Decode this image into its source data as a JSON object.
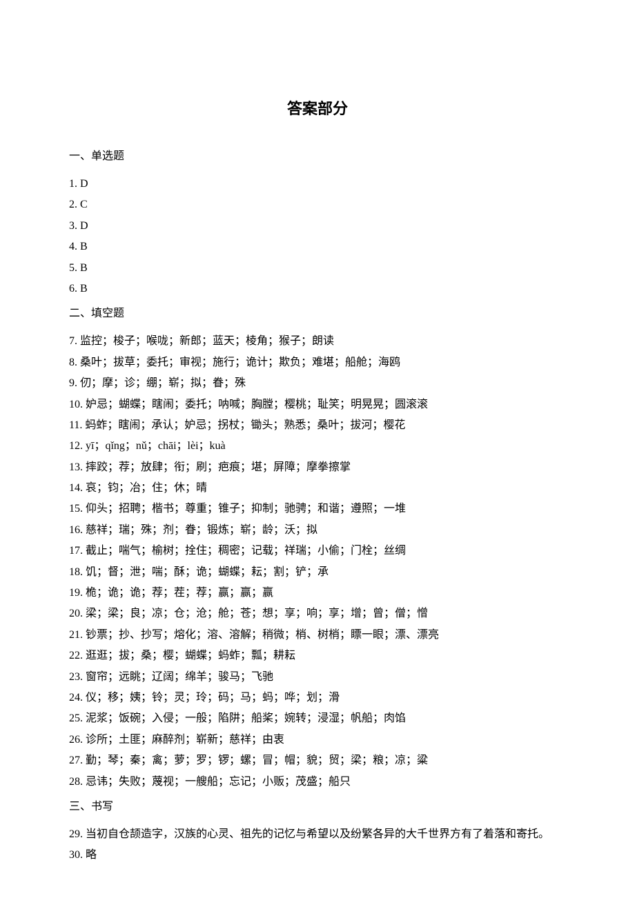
{
  "title": "答案部分",
  "sections": [
    {
      "heading": "一、单选题",
      "items": [
        {
          "num": "1.",
          "text": "D"
        },
        {
          "num": "2.",
          "text": "C"
        },
        {
          "num": "3.",
          "text": "D"
        },
        {
          "num": "4.",
          "text": "B"
        },
        {
          "num": "5.",
          "text": "B"
        },
        {
          "num": "6.",
          "text": "B"
        }
      ]
    },
    {
      "heading": "二、填空题",
      "items": [
        {
          "num": "7.",
          "text": "监控；梭子；喉咙；新郎；蓝天；棱角；猴子；朗读"
        },
        {
          "num": "8.",
          "text": "桑叶；拔草；委托；审视；施行；诡计；欺负；难堪；船舱；海鸥"
        },
        {
          "num": "9.",
          "text": "仞；摩；诊；绷；崭；拟；眷；殊"
        },
        {
          "num": "10.",
          "text": "妒忌；蝴蝶；瞎闹；委托；呐喊；胸膛；樱桃；耻笑；明晃晃；圆滚滚"
        },
        {
          "num": "11.",
          "text": "蚂蚱；瞎闹；承认；妒忌；拐杖；锄头；熟悉；桑叶；拔河；樱花"
        },
        {
          "num": "12.",
          "text": "yī；qǐng；nǔ；chāi；lèi；kuà"
        },
        {
          "num": "13.",
          "text": "摔跤；荐；放肆；衔；刷；疤痕；堪；屏障；摩拳擦掌"
        },
        {
          "num": "14.",
          "text": "哀；钧；冶；住；休；晴"
        },
        {
          "num": "15.",
          "text": "仰头；招聘；楷书；尊重；锥子；抑制；驰骋；和谐；遵照；一堆"
        },
        {
          "num": "16.",
          "text": "慈祥；瑞；殊；剂；眷；锻炼；崭；龄；沃；拟"
        },
        {
          "num": "17.",
          "text": "截止；喘气；榆树；拴住；稠密；记载；祥瑞；小偷；门栓；丝绸"
        },
        {
          "num": "18.",
          "text": "饥；督；泄；喘；酥；诡；蝴蝶；耘；割；铲；承"
        },
        {
          "num": "19.",
          "text": "桅；诡；诡；荐；茬；荐；赢；赢；赢"
        },
        {
          "num": "20.",
          "text": "梁；梁；良；凉；仓；沧；舱；苍；想；享；响；享；增；曾；僧；憎"
        },
        {
          "num": "21.",
          "text": "钞票；抄、抄写；熔化；溶、溶解；稍微；梢、树梢；瞟一眼；漂、漂亮"
        },
        {
          "num": "22.",
          "text": "逛逛；拔；桑；樱；蝴蝶；蚂蚱；瓢；耕耘"
        },
        {
          "num": "23.",
          "text": "窗帘；远眺；辽阔；绵羊；骏马；飞驰"
        },
        {
          "num": "24.",
          "text": "仪；移；姨；铃；灵；玲；码；马；蚂；哗；划；滑"
        },
        {
          "num": "25.",
          "text": "泥浆；饭碗；入侵；一般；陷阱；船桨；婉转；浸湿；帆船；肉馅"
        },
        {
          "num": "26.",
          "text": "诊所；土匪；麻醉剂；崭新；慈祥；由衷"
        },
        {
          "num": "27.",
          "text": "勤；琴；秦；禽；萝；罗；锣；螺；冒；帽；貌；贸；梁；粮；凉；粱"
        },
        {
          "num": "28.",
          "text": "忌讳；失败；蔑视；一艘船；忘记；小贩；茂盛；船只"
        }
      ]
    },
    {
      "heading": "三、书写",
      "items": [
        {
          "num": "29.",
          "text": "当初自仓颉造字，汉族的心灵、祖先的记忆与希望以及纷繁各异的大千世界方有了着落和寄托。"
        },
        {
          "num": "30.",
          "text": "略"
        }
      ]
    }
  ]
}
